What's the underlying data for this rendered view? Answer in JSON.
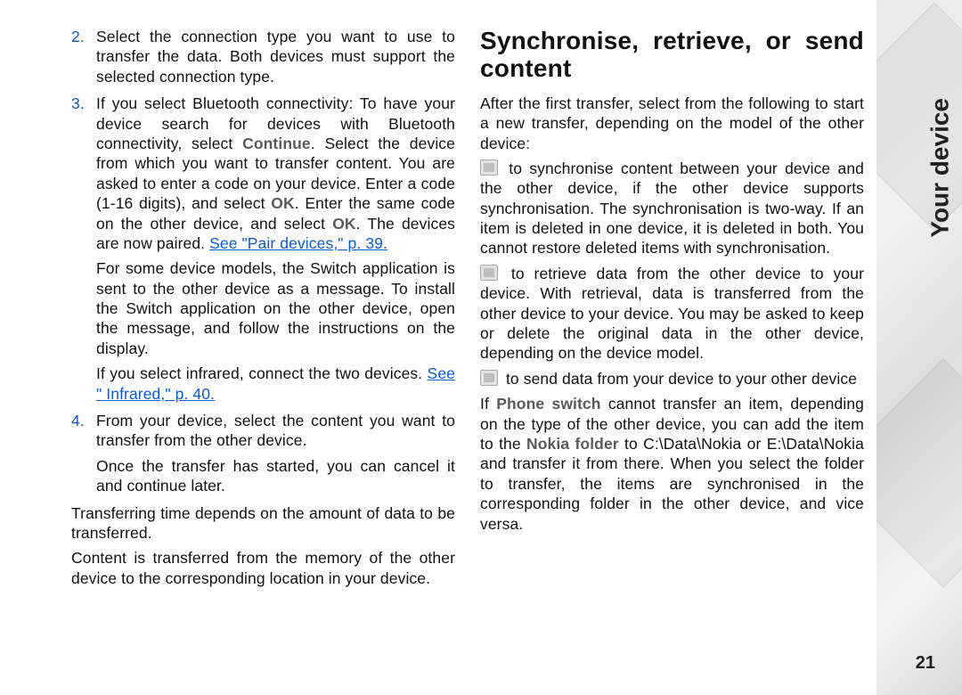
{
  "sidetab": {
    "label": "Your device"
  },
  "page_number": "21",
  "left": {
    "items": [
      {
        "num": "2.",
        "paras": [
          {
            "runs": [
              {
                "t": "Select the connection type you want to use to transfer the data. Both devices must support the selected connection type."
              }
            ]
          }
        ]
      },
      {
        "num": "3.",
        "paras": [
          {
            "runs": [
              {
                "t": "If you select Bluetooth connectivity: To have your device search for devices with Bluetooth connectivity, select "
              },
              {
                "t": "Continue",
                "bold": true
              },
              {
                "t": ". Select the device from which you want to transfer content. You are asked to enter a code on your device. Enter a code (1-16 digits), and select "
              },
              {
                "t": "OK",
                "bold": true
              },
              {
                "t": ". Enter the same code on the other device, and select "
              },
              {
                "t": "OK",
                "bold": true
              },
              {
                "t": ". The devices are now paired. "
              },
              {
                "t": "See \"Pair devices,\" p. 39.",
                "link": true
              }
            ]
          },
          {
            "runs": [
              {
                "t": "For some device models, the Switch application is sent to the other device as a message. To install the Switch application on the other device, open the message, and follow the instructions on the display."
              }
            ]
          },
          {
            "runs": [
              {
                "t": "If you select infrared, connect the two devices. "
              },
              {
                "t": "See \" Infrared,\" p. 40.",
                "link": true
              }
            ]
          }
        ]
      },
      {
        "num": "4.",
        "paras": [
          {
            "runs": [
              {
                "t": "From your device, select the content you want to transfer from the other device."
              }
            ]
          },
          {
            "runs": [
              {
                "t": "Once the transfer has started, you can cancel it and continue later."
              }
            ]
          }
        ]
      }
    ],
    "after": [
      {
        "runs": [
          {
            "t": "Transferring time depends on the amount of data to be transferred."
          }
        ]
      },
      {
        "runs": [
          {
            "t": "Content is transferred from the memory of the other device to the corresponding location in your device."
          }
        ]
      }
    ]
  },
  "right": {
    "heading": "Synchronise, retrieve, or send content",
    "paras": [
      {
        "runs": [
          {
            "t": "After the first transfer, select from the following to start a new transfer, depending on the model of the other device:"
          }
        ]
      },
      {
        "icon": "sync-icon",
        "runs": [
          {
            "t": " to synchronise content between your device and the other device, if the other device supports synchronisation. The synchronisation is two-way. If an item is deleted in one device, it is deleted in both. You cannot restore deleted items with synchronisation."
          }
        ]
      },
      {
        "icon": "retrieve-icon",
        "runs": [
          {
            "t": " to retrieve data from the other device to your device. With retrieval, data is transferred from the other device to your device. You may be asked to keep or delete the original data in the other device, depending on the device model."
          }
        ]
      },
      {
        "icon": "send-icon",
        "runs": [
          {
            "t": " to send data from your device to your other device"
          }
        ]
      },
      {
        "runs": [
          {
            "t": "If "
          },
          {
            "t": "Phone switch",
            "bold": true
          },
          {
            "t": " cannot transfer an item, depending on the type of the other device, you can add the item to the "
          },
          {
            "t": "Nokia folder",
            "bold": true
          },
          {
            "t": " to C:\\Data\\Nokia or E:\\Data\\Nokia and transfer it from there. When you select the folder to transfer, the items are synchronised in the corresponding folder in the other device, and vice versa."
          }
        ]
      }
    ]
  }
}
